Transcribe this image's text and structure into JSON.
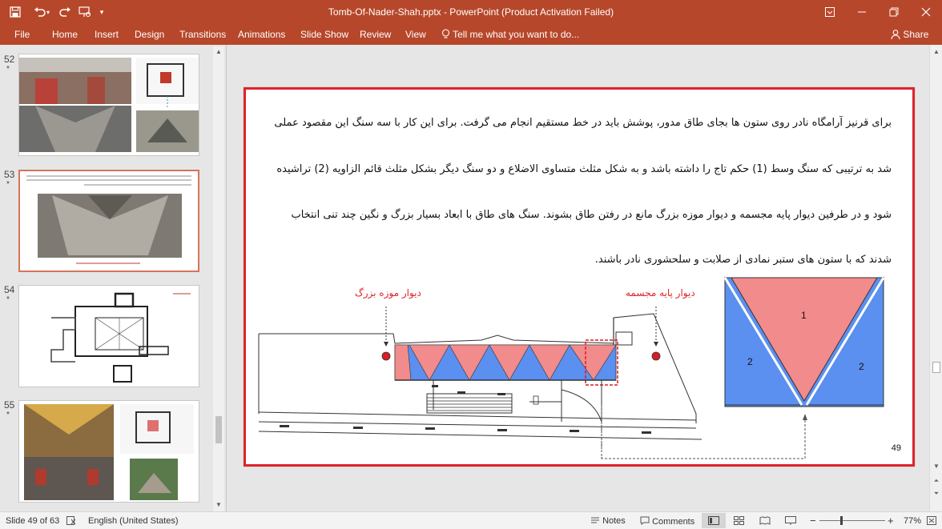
{
  "window": {
    "title": "Tomb-Of-Nader-Shah.pptx - PowerPoint (Product Activation Failed)",
    "icons": [
      "save-icon",
      "undo-icon",
      "redo-icon",
      "present-icon",
      "customize-icon",
      "ribbon-display-icon",
      "minimize-icon",
      "restore-icon",
      "close-icon"
    ]
  },
  "ribbon": {
    "tabs": [
      "File",
      "Home",
      "Insert",
      "Design",
      "Transitions",
      "Animations",
      "Slide Show",
      "Review",
      "View"
    ],
    "tell_me": "Tell me what you want to do...",
    "share": "Share"
  },
  "thumbnails": [
    {
      "number": "52",
      "star": "*"
    },
    {
      "number": "53",
      "star": "*"
    },
    {
      "number": "54",
      "star": "*"
    },
    {
      "number": "55",
      "star": "*"
    }
  ],
  "slide": {
    "paragraph_lines": [
      "برای قرنیز آرامگاه نادر روی ستون ها بجای طاق مدور، پوشش باید در خط مستقیم انجام می گرفت. برای این کار با سه سنگ این مقصود عملی",
      "شد به ترتیبی که سنگ وسط (1) حکم تاج را داشته باشد و به شکل مثلث متساوی الاضلاع و دو سنگ دیگر بشکل مثلث قائم الزاویه (2) تراشیده",
      "شود و در طرفین دیوار پایه مجسمه و دیوار موزه بزرگ مانع در رفتن طاق بشوند. سنگ های طاق با ابعاد بسیار بزرگ و نگین چند تنی انتخاب",
      "شدند که با ستون های ستبر نمادی از صلابت و سلحشوری نادر باشند."
    ],
    "label_museum_wall": "دیوار موزه بزرگ",
    "label_statue_wall": "دیوار پایه مجسمه",
    "triangle_labels": {
      "center": "1",
      "left": "2",
      "right": "2"
    },
    "page_number": "49",
    "colors": {
      "red_triangle": "#f28b8b",
      "blue_triangle": "#5b8ff0",
      "frame": "#e0232a"
    }
  },
  "statusbar": {
    "slide_info": "Slide 49 of 63",
    "language": "English (United States)",
    "notes": "Notes",
    "comments": "Comments",
    "zoom": "77%"
  }
}
